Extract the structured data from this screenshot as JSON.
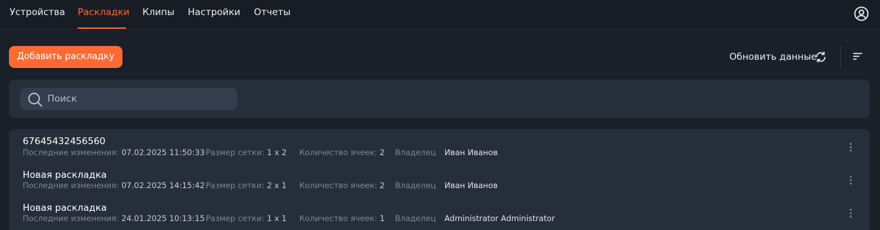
{
  "nav": {
    "items": [
      {
        "label": "Устройства"
      },
      {
        "label": "Раскладки",
        "active": true
      },
      {
        "label": "Клипы"
      },
      {
        "label": "Настройки"
      },
      {
        "label": "Отчеты"
      }
    ],
    "user_icon": "user-circle-icon"
  },
  "toolbar": {
    "add_label": "Добавить раскладку",
    "refresh_label": "Обновить данные",
    "refresh_icon": "refresh-icon",
    "sort_icon": "sort-lines-icon"
  },
  "search": {
    "placeholder": "Поиск",
    "value": "",
    "icon": "search-icon"
  },
  "labels": {
    "last_change": "Последние изменения:",
    "grid_size": "Размер сетки:",
    "cell_count": "Количество ячеек:",
    "owner": "Владелец"
  },
  "layouts": [
    {
      "name": "67645432456560",
      "updated": "07.02.2025 11:50:33",
      "grid": "1 x 2",
      "cells": "2",
      "owner": "Иван Иванов"
    },
    {
      "name": "Новая раскладка",
      "updated": "07.02.2025 14:15:42",
      "grid": "2 x 1",
      "cells": "2",
      "owner": "Иван Иванов"
    },
    {
      "name": "Новая раскладка",
      "updated": "24.01.2025 10:13:15",
      "grid": "1 x 1",
      "cells": "1",
      "owner": "Administrator Administrator"
    }
  ],
  "colors": {
    "accent": "#ff6a33",
    "background": "#1a2029",
    "panel": "#262e3a"
  }
}
